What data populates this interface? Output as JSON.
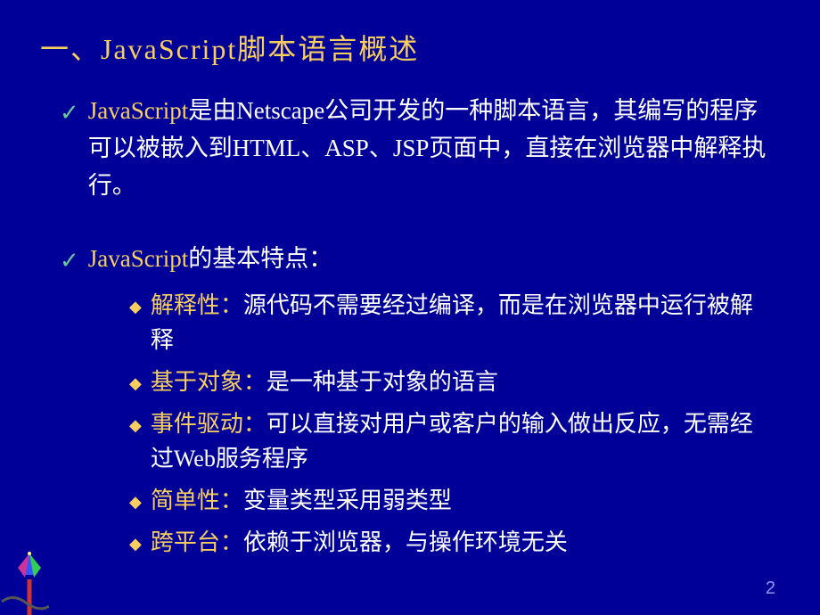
{
  "title": "一、JavaScript脚本语言概述",
  "b1": {
    "hl": "JavaScript",
    "rest": "是由Netscape公司开发的一种脚本语言，其编写的程序可以被嵌入到HTML、ASP、JSP页面中，直接在浏览器中解释执行。"
  },
  "b2": {
    "hl": "JavaScript",
    "rest": "的基本特点："
  },
  "sub": [
    {
      "hl": "解释性：",
      "rest": "源代码不需要经过编译，而是在浏览器中运行被解释"
    },
    {
      "hl": "基于对象：",
      "rest": "是一种基于对象的语言"
    },
    {
      "hl": "事件驱动：",
      "rest": "可以直接对用户或客户的输入做出反应，无需经过Web服务程序"
    },
    {
      "hl": "简单性：",
      "rest": "变量类型采用弱类型"
    },
    {
      "hl": "跨平台：",
      "rest": "依赖于浏览器，与操作环境无关"
    }
  ],
  "pageNumber": "2"
}
